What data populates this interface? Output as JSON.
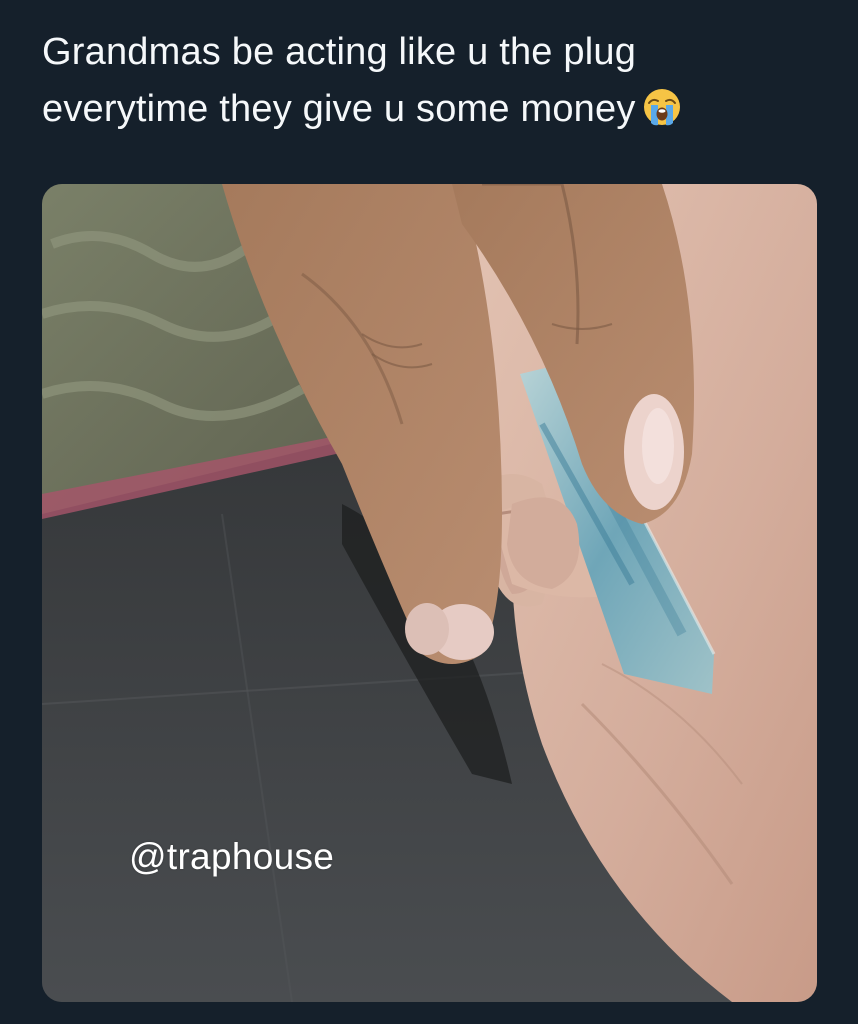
{
  "tweet": {
    "text_line_1": "Grandmas be acting like u the plug",
    "text_line_2": "everytime they give u some money",
    "emoji": "loudly-crying-face"
  },
  "media": {
    "watermark": "@traphouse"
  }
}
